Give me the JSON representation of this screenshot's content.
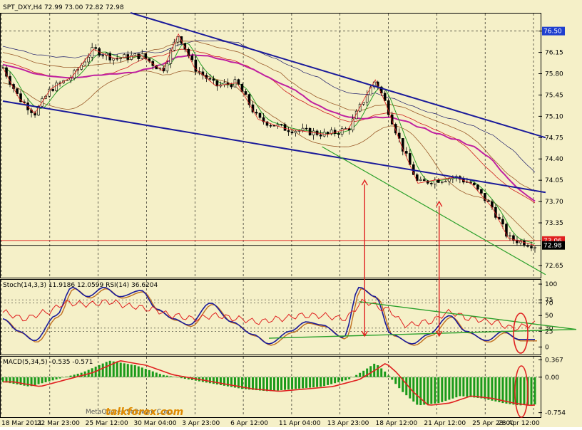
{
  "chart_data": [
    {
      "type": "candlestick",
      "title": "SPT_DXY,H4  72.99 73.00 72.82 72.98",
      "y_ticks": [
        "76.50",
        "76.15",
        "75.80",
        "75.45",
        "75.10",
        "74.75",
        "74.40",
        "74.05",
        "73.70",
        "73.35",
        "73.06",
        "72.98",
        "72.65"
      ],
      "y_tick_values": [
        76.5,
        76.15,
        75.8,
        75.45,
        75.1,
        74.75,
        74.4,
        74.05,
        73.7,
        73.35,
        73.06,
        72.98,
        72.65
      ],
      "ylim": [
        72.45,
        76.8
      ],
      "price_labels": [
        {
          "text": "76.50",
          "value": 76.5,
          "bg": "#1f3fcf"
        },
        {
          "text": "73.06",
          "value": 73.06,
          "bg": "#e02020"
        },
        {
          "text": "72.98",
          "value": 72.98,
          "bg": "#000000"
        }
      ],
      "x_labels": [
        "18 Mar 2011",
        "22 Mar 23:00",
        "25 Mar 12:00",
        "30 Mar 04:00",
        "3 Apr 23:00",
        "6 Apr 12:00",
        "11 Apr 04:00",
        "13 Apr 23:00",
        "18 Apr 12:00",
        "21 Apr 12:00",
        "25 Apr 23:00",
        "28 Apr 12:00"
      ],
      "key_levels": [
        {
          "t": 0.0,
          "v": 75.9
        },
        {
          "t": 0.03,
          "v": 75.4
        },
        {
          "t": 0.06,
          "v": 75.15
        },
        {
          "t": 0.09,
          "v": 75.55
        },
        {
          "t": 0.13,
          "v": 75.75
        },
        {
          "t": 0.17,
          "v": 76.2
        },
        {
          "t": 0.21,
          "v": 76.05
        },
        {
          "t": 0.26,
          "v": 76.1
        },
        {
          "t": 0.3,
          "v": 75.85
        },
        {
          "t": 0.33,
          "v": 76.45
        },
        {
          "t": 0.36,
          "v": 75.9
        },
        {
          "t": 0.4,
          "v": 75.6
        },
        {
          "t": 0.44,
          "v": 75.65
        },
        {
          "t": 0.48,
          "v": 75.05
        },
        {
          "t": 0.53,
          "v": 74.9
        },
        {
          "t": 0.57,
          "v": 74.85
        },
        {
          "t": 0.61,
          "v": 74.8
        },
        {
          "t": 0.65,
          "v": 74.9
        },
        {
          "t": 0.68,
          "v": 75.4
        },
        {
          "t": 0.7,
          "v": 75.7
        },
        {
          "t": 0.72,
          "v": 75.3
        },
        {
          "t": 0.75,
          "v": 74.6
        },
        {
          "t": 0.78,
          "v": 74.0
        },
        {
          "t": 0.81,
          "v": 74.05
        },
        {
          "t": 0.85,
          "v": 74.1
        },
        {
          "t": 0.88,
          "v": 74.0
        },
        {
          "t": 0.92,
          "v": 73.6
        },
        {
          "t": 0.95,
          "v": 73.1
        },
        {
          "t": 1.0,
          "v": 72.98
        }
      ],
      "trend_lines": [
        {
          "name": "upper-channel",
          "color": "#1a1a9a",
          "from": [
            0.24,
            76.8
          ],
          "to": [
            1.02,
            74.75
          ]
        },
        {
          "name": "lower-channel",
          "color": "#1a1a9a",
          "from": [
            0.0,
            75.35
          ],
          "to": [
            1.02,
            73.85
          ]
        },
        {
          "name": "green-support",
          "color": "#2aa02a",
          "from": [
            0.6,
            74.6
          ],
          "to": [
            1.02,
            72.5
          ]
        }
      ],
      "arrows": [
        {
          "t": 0.68,
          "from": 72.95,
          "to": 74.05
        },
        {
          "t": 0.82,
          "from": 72.95,
          "to": 73.7
        }
      ],
      "ma_colors": {
        "green": "#2aa02a",
        "brown": "#9b5b2a",
        "red": "#d02020",
        "magenta": "#c020a0",
        "navy": "#1a1a6a"
      }
    },
    {
      "type": "line",
      "title": "Stoch(14,3,3) 11.9186 12.0599  RSI(14) 36.6204",
      "y_ticks": [
        "100",
        "75",
        "70",
        "50",
        "30",
        "25",
        "0"
      ],
      "y_tick_values": [
        100,
        75,
        70,
        50,
        30,
        25,
        0
      ],
      "ylim": [
        -12,
        108
      ],
      "series": [
        {
          "name": "Stoch(14,3,3)",
          "color": "#1a1a9a",
          "points": [
            [
              0,
              45
            ],
            [
              0.03,
              25
            ],
            [
              0.06,
              10
            ],
            [
              0.1,
              50
            ],
            [
              0.13,
              95
            ],
            [
              0.16,
              80
            ],
            [
              0.19,
              95
            ],
            [
              0.22,
              80
            ],
            [
              0.26,
              90
            ],
            [
              0.29,
              60
            ],
            [
              0.32,
              45
            ],
            [
              0.35,
              35
            ],
            [
              0.39,
              70
            ],
            [
              0.43,
              40
            ],
            [
              0.47,
              20
            ],
            [
              0.5,
              5
            ],
            [
              0.54,
              25
            ],
            [
              0.57,
              40
            ],
            [
              0.6,
              35
            ],
            [
              0.64,
              15
            ],
            [
              0.67,
              95
            ],
            [
              0.7,
              80
            ],
            [
              0.73,
              20
            ],
            [
              0.77,
              5
            ],
            [
              0.8,
              20
            ],
            [
              0.84,
              50
            ],
            [
              0.87,
              25
            ],
            [
              0.91,
              10
            ],
            [
              0.94,
              25
            ],
            [
              0.97,
              12
            ],
            [
              1.0,
              12
            ]
          ]
        },
        {
          "name": "RSI(14)",
          "color": "#e02020",
          "points": [
            [
              0,
              55
            ],
            [
              0.04,
              45
            ],
            [
              0.08,
              55
            ],
            [
              0.12,
              70
            ],
            [
              0.16,
              68
            ],
            [
              0.2,
              72
            ],
            [
              0.24,
              65
            ],
            [
              0.28,
              60
            ],
            [
              0.32,
              50
            ],
            [
              0.36,
              45
            ],
            [
              0.4,
              50
            ],
            [
              0.44,
              45
            ],
            [
              0.48,
              40
            ],
            [
              0.52,
              45
            ],
            [
              0.56,
              50
            ],
            [
              0.6,
              50
            ],
            [
              0.64,
              45
            ],
            [
              0.68,
              72
            ],
            [
              0.72,
              60
            ],
            [
              0.76,
              35
            ],
            [
              0.8,
              40
            ],
            [
              0.84,
              55
            ],
            [
              0.88,
              45
            ],
            [
              0.92,
              40
            ],
            [
              0.96,
              30
            ],
            [
              1.0,
              36.6
            ]
          ]
        }
      ]
    },
    {
      "type": "bar",
      "title": "MACD(5,34,5) -0.535 -0.571",
      "y_ticks": [
        "0.367",
        "0.00",
        "-0.754"
      ],
      "y_tick_values": [
        0.367,
        0.0,
        -0.754
      ],
      "ylim": [
        -0.85,
        0.45
      ],
      "histogram": [
        {
          "t": 0.0,
          "v": -0.1
        },
        {
          "t": 0.05,
          "v": -0.2
        },
        {
          "t": 0.1,
          "v": -0.05
        },
        {
          "t": 0.15,
          "v": 0.1
        },
        {
          "t": 0.2,
          "v": 0.35
        },
        {
          "t": 0.25,
          "v": 0.25
        },
        {
          "t": 0.3,
          "v": 0.05
        },
        {
          "t": 0.35,
          "v": -0.05
        },
        {
          "t": 0.4,
          "v": -0.15
        },
        {
          "t": 0.45,
          "v": -0.25
        },
        {
          "t": 0.5,
          "v": -0.3
        },
        {
          "t": 0.55,
          "v": -0.25
        },
        {
          "t": 0.6,
          "v": -0.2
        },
        {
          "t": 0.65,
          "v": -0.05
        },
        {
          "t": 0.68,
          "v": 0.15
        },
        {
          "t": 0.7,
          "v": 0.3
        },
        {
          "t": 0.72,
          "v": 0.1
        },
        {
          "t": 0.75,
          "v": -0.3
        },
        {
          "t": 0.78,
          "v": -0.6
        },
        {
          "t": 0.82,
          "v": -0.55
        },
        {
          "t": 0.86,
          "v": -0.4
        },
        {
          "t": 0.9,
          "v": -0.45
        },
        {
          "t": 0.94,
          "v": -0.55
        },
        {
          "t": 0.97,
          "v": -0.6
        },
        {
          "t": 1.0,
          "v": -0.58
        }
      ],
      "signal_line_color": "#e02020"
    }
  ],
  "watermark": "MetaQuotes Software Corp.",
  "logo": "talkforex.com"
}
